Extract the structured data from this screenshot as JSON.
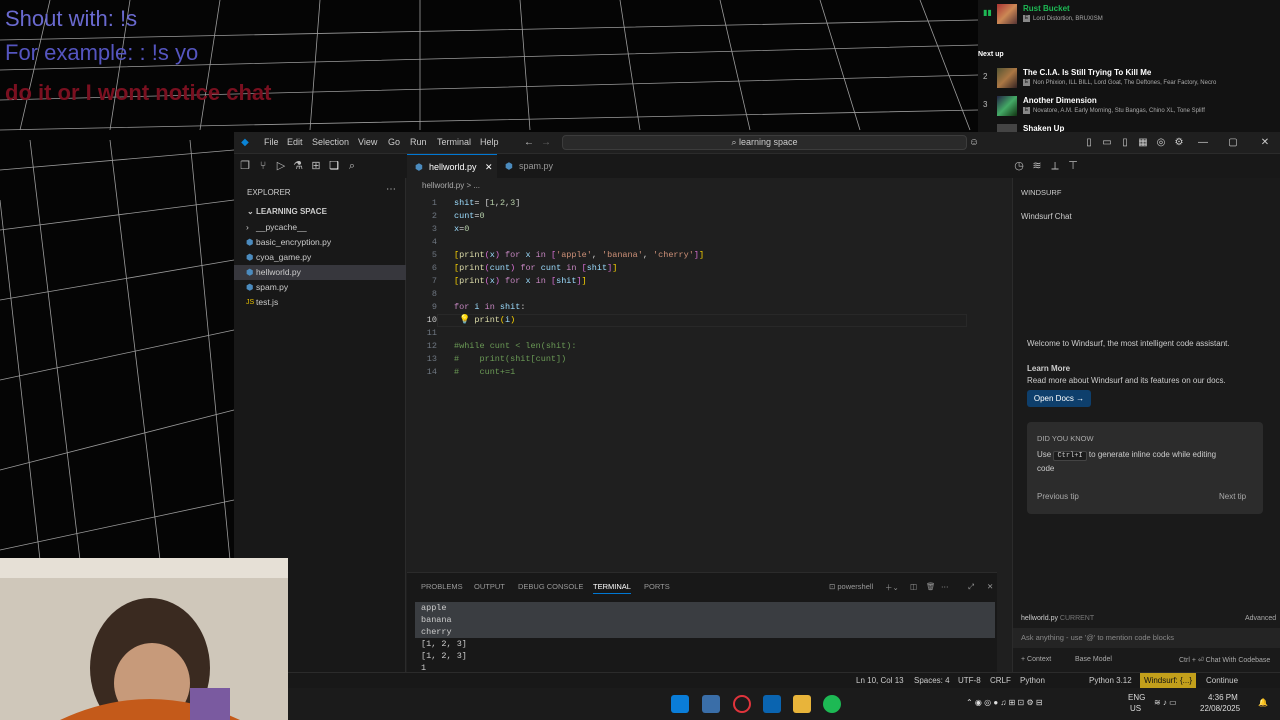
{
  "overlay": {
    "line1": "Shout with: !s",
    "line2": "For example: : !s yo",
    "line3": "do it or I wont notice chat"
  },
  "spotify": {
    "current": {
      "title": "Rust Bucket",
      "artist": "Lord Distortion, BRUXISM"
    },
    "next_up_label": "Next up",
    "queue": [
      {
        "num": "2",
        "title": "The C.I.A. Is Still Trying To Kill Me",
        "artist": "Non Phixion, ILL BILL, Lord Goat, The Deftones, Fear Factory, Necro"
      },
      {
        "num": "3",
        "title": "Another Dimension",
        "artist": "Novatore, A.M. Early Morning, Stu Bangas, Chino XL, Tone Spliff"
      },
      {
        "num": "",
        "title": "Shaken Up",
        "artist": ""
      }
    ]
  },
  "vscode": {
    "menu": [
      "File",
      "Edit",
      "Selection",
      "View",
      "Go",
      "Run",
      "Terminal",
      "Help"
    ],
    "search": "learning space",
    "sidebar": {
      "title": "EXPLORER",
      "folder": "LEARNING SPACE",
      "files": [
        {
          "name": "__pycache__",
          "type": "folder"
        },
        {
          "name": "basic_encryption.py",
          "type": "py"
        },
        {
          "name": "cyoa_game.py",
          "type": "py"
        },
        {
          "name": "hellworld.py",
          "type": "py",
          "active": true
        },
        {
          "name": "spam.py",
          "type": "py"
        },
        {
          "name": "test.js",
          "type": "js"
        }
      ]
    },
    "tabs": [
      {
        "label": "hellworld.py",
        "active": true
      },
      {
        "label": "spam.py",
        "active": false
      }
    ],
    "breadcrumb": "hellworld.py > ...",
    "line_numbers": [
      "1",
      "2",
      "3",
      "4",
      "5",
      "6",
      "7",
      "8",
      "9",
      "10",
      "11",
      "12",
      "13",
      "14"
    ],
    "code_tokens": [
      [
        [
          "vr",
          "shit"
        ],
        [
          "",
          "= ["
        ],
        [
          "nm",
          "1"
        ],
        [
          "",
          ","
        ],
        [
          "nm",
          "2"
        ],
        [
          "",
          ","
        ],
        [
          "nm",
          "3"
        ],
        [
          "",
          "]"
        ]
      ],
      [
        [
          "vr",
          "cunt"
        ],
        [
          "",
          "="
        ],
        [
          "nm",
          "0"
        ]
      ],
      [
        [
          "vr",
          "x"
        ],
        [
          "",
          "="
        ],
        [
          "nm",
          "0"
        ]
      ],
      [],
      [
        [
          "br",
          "["
        ],
        [
          "fn",
          "print"
        ],
        [
          "br2",
          "("
        ],
        [
          "vr",
          "x"
        ],
        [
          "br2",
          ")"
        ],
        [
          "kw",
          " for "
        ],
        [
          "vr",
          "x"
        ],
        [
          "kw",
          " in "
        ],
        [
          "br2",
          "["
        ],
        [
          "st",
          "'apple'"
        ],
        [
          "",
          ", "
        ],
        [
          "st",
          "'banana'"
        ],
        [
          "",
          ", "
        ],
        [
          "st",
          "'cherry'"
        ],
        [
          "br2",
          "]"
        ],
        [
          "br",
          "]"
        ]
      ],
      [
        [
          "br",
          "["
        ],
        [
          "fn",
          "print"
        ],
        [
          "br2",
          "("
        ],
        [
          "vr",
          "cunt"
        ],
        [
          "br2",
          ")"
        ],
        [
          "kw",
          " for "
        ],
        [
          "vr",
          "cunt"
        ],
        [
          "kw",
          " in "
        ],
        [
          "br2",
          "["
        ],
        [
          "vr",
          "shit"
        ],
        [
          "br2",
          "]"
        ],
        [
          "br",
          "]"
        ]
      ],
      [
        [
          "br",
          "["
        ],
        [
          "fn",
          "print"
        ],
        [
          "br2",
          "("
        ],
        [
          "vr",
          "x"
        ],
        [
          "br2",
          ")"
        ],
        [
          "kw",
          " for "
        ],
        [
          "vr",
          "x"
        ],
        [
          "kw",
          " in "
        ],
        [
          "br2",
          "["
        ],
        [
          "vr",
          "shit"
        ],
        [
          "br2",
          "]"
        ],
        [
          "br",
          "]"
        ]
      ],
      [],
      [
        [
          "kw",
          "for "
        ],
        [
          "vr",
          "i"
        ],
        [
          "kw",
          " in "
        ],
        [
          "vr",
          "shit"
        ],
        [
          "",
          ":"
        ]
      ],
      [
        [
          "",
          "    "
        ],
        [
          "fn",
          "print"
        ],
        [
          "br",
          "("
        ],
        [
          "vr",
          "i"
        ],
        [
          "br",
          ")"
        ]
      ],
      [],
      [
        [
          "cm",
          "#while cunt < len(shit):"
        ]
      ],
      [
        [
          "cm",
          "#    print(shit[cunt])"
        ]
      ],
      [
        [
          "cm",
          "#    cunt+=1"
        ]
      ]
    ],
    "panel_tabs": [
      "PROBLEMS",
      "OUTPUT",
      "DEBUG CONSOLE",
      "TERMINAL",
      "PORTS"
    ],
    "terminal_shell": "powershell",
    "terminal_lines": [
      "apple",
      "banana",
      "cherry",
      "[1, 2, 3]",
      "[1, 2, 3]",
      "1"
    ],
    "windsurf": {
      "header": "WINDSURF",
      "chat_title": "Windsurf Chat",
      "welcome": "Welcome to Windsurf, the most intelligent code assistant.",
      "learn_more": "Learn More",
      "learn_text": "Read more about Windsurf and its features on our docs.",
      "open_docs": "Open Docs →",
      "did_you_know": "DID YOU KNOW",
      "tip_pre": "Use",
      "tip_key": "Ctrl+I",
      "tip_post": "to generate inline code while editing",
      "tip_post2": "code",
      "prev_tip": "Previous tip",
      "next_tip": "Next tip",
      "file_chip": "hellworld.py",
      "file_chip_tag": "CURRENT",
      "advanced": "Advanced",
      "input_placeholder": "Ask anything - use '@' to mention code blocks",
      "context": "+ Context",
      "base_model": "Base Model",
      "shortcut": "Ctrl + ⏎  Chat With Codebase"
    },
    "status": {
      "position": "Ln 10, Col 13",
      "spaces": "Spaces: 4",
      "encoding": "UTF-8",
      "eol": "CRLF",
      "lang": "Python",
      "interpreter": "Python 3.12",
      "windsurf": "Windsurf: {...}",
      "autocomplete": "Continue"
    }
  },
  "taskbar": {
    "lang1": "ENG",
    "lang2": "US",
    "time": "4:36 PM",
    "date": "22/08/2025"
  }
}
